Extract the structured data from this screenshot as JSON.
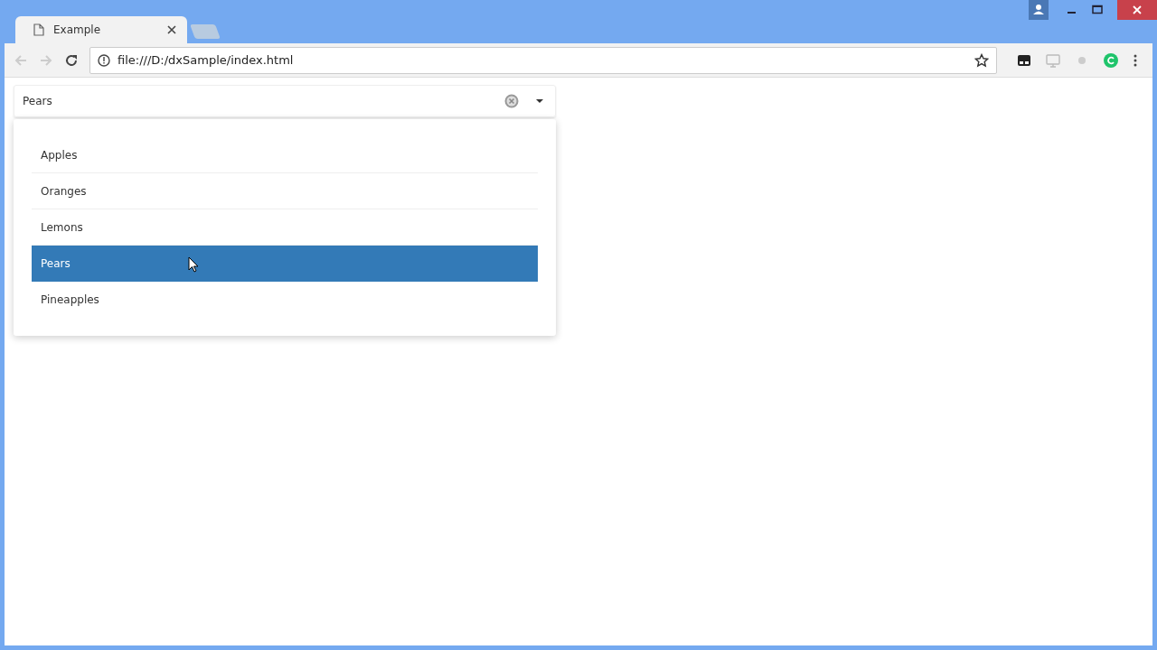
{
  "tabs": [
    {
      "title": "Example",
      "selected": true
    }
  ],
  "address_bar": {
    "url": "file:///D:/dxSample/index.html"
  },
  "select_box": {
    "value": "Pears",
    "opened": true,
    "items": [
      {
        "label": "Apples",
        "selected": false
      },
      {
        "label": "Oranges",
        "selected": false
      },
      {
        "label": "Lemons",
        "selected": false
      },
      {
        "label": "Pears",
        "selected": true
      },
      {
        "label": "Pineapples",
        "selected": false
      }
    ]
  }
}
